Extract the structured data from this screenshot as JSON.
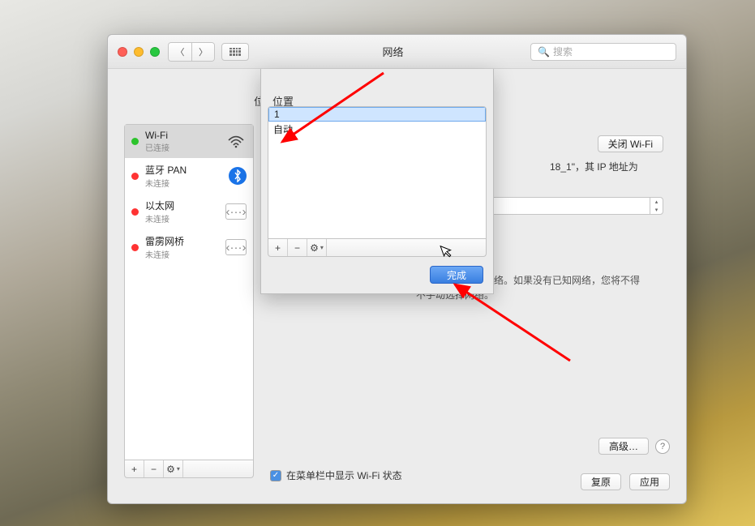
{
  "titlebar": {
    "title": "网络",
    "search_placeholder": "搜索"
  },
  "main": {
    "location_label": "位",
    "sidebar": [
      {
        "name": "Wi-Fi",
        "sub": "已连接",
        "icon": "wifi",
        "status": "green"
      },
      {
        "name": "蓝牙 PAN",
        "sub": "未连接",
        "icon": "bt",
        "status": "red"
      },
      {
        "name": "以太网",
        "sub": "未连接",
        "icon": "eth",
        "status": "red"
      },
      {
        "name": "雷雳网桥",
        "sub": "未连接",
        "icon": "eth",
        "status": "red"
      }
    ],
    "wifi_off_btn": "关闭 Wi-Fi",
    "info_text": "18_1\"，其 IP 地址为",
    "auto_join_text": "将自动加入已知网络。如果没有已知网络，您将不得不手动选择网络。",
    "checkbox_label": "在菜单栏中显示 Wi-Fi 状态",
    "advanced_btn": "高级…",
    "revert_btn": "复原",
    "apply_btn": "应用"
  },
  "sheet": {
    "label": "位置",
    "rows": [
      {
        "text": "1",
        "editing": true
      },
      {
        "text": "自动",
        "editing": false
      }
    ],
    "done_btn": "完成"
  }
}
